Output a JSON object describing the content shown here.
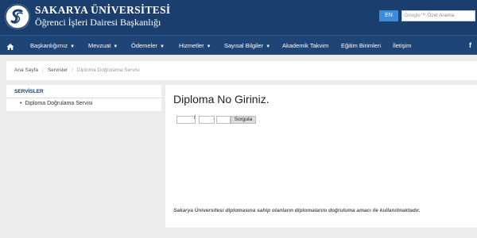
{
  "header": {
    "university_name": "SAKARYA ÜNİVERSİTESİ",
    "department_name": "Öğrenci İşleri Dairesi Başkanlığı",
    "language_button": "EN",
    "search_brand": "Google™",
    "search_placeholder": "Özel Arama",
    "colors": {
      "header_bg": "#1a3f6e",
      "nav_bg": "#1f4577",
      "accent": "#3a8bd9"
    }
  },
  "nav": {
    "home_icon": "home-icon",
    "items": [
      {
        "label": "Başkanlığımız",
        "has_dropdown": true
      },
      {
        "label": "Mevzuat",
        "has_dropdown": true
      },
      {
        "label": "Ödemeler",
        "has_dropdown": true
      },
      {
        "label": "Hizmetler",
        "has_dropdown": true
      },
      {
        "label": "Sayısal Bilgiler",
        "has_dropdown": true
      },
      {
        "label": "Akademik Takvim",
        "has_dropdown": false
      },
      {
        "label": "Eğitim Birimleri",
        "has_dropdown": false
      },
      {
        "label": "İletişim",
        "has_dropdown": false
      }
    ],
    "social_label": "f",
    "social_icon": "facebook-icon"
  },
  "breadcrumb": {
    "items": [
      "Ana Sayfa",
      "Servisler",
      "Diploma Doğrulama Servisi"
    ],
    "separator": "/"
  },
  "sidebar": {
    "title": "SERVİSLER",
    "links": [
      {
        "label": "Diploma Doğrulama Servisi"
      }
    ]
  },
  "main": {
    "title": "Diploma No Giriniz.",
    "field_separator_1": "/",
    "field_separator_2": ",",
    "submit_label": "Sorgula",
    "note": "Sakarya Üniversitesi diplomasına sahip olanların diplomalarını doğruluma amacı ile kullanılmaktadır."
  }
}
